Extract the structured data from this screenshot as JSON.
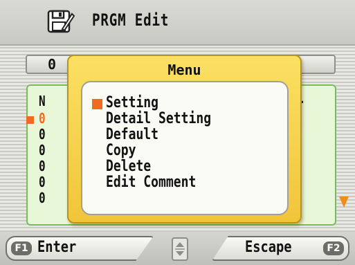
{
  "header": {
    "title": "PRGM Edit",
    "icon": "floppy-pencil-icon"
  },
  "background_list": {
    "header_text": "0",
    "rows": [
      "N",
      "0",
      "0",
      "0",
      "0",
      "0",
      "0"
    ],
    "selected_row_index": 1,
    "tail_text": "-"
  },
  "menu": {
    "title": "Menu",
    "items": [
      "Setting",
      "Detail Setting",
      "Default",
      "Copy",
      "Delete",
      "Edit Comment"
    ],
    "selected_index": 0
  },
  "footer": {
    "left_key": "F1",
    "left_label": "Enter",
    "right_key": "F2",
    "right_label": "Escape",
    "updown_icon": "up-down-arrows-icon"
  },
  "colors": {
    "accent_orange": "#ef6b1f",
    "menu_yellow": "#f7d24b",
    "list_green": "#78bb5e"
  }
}
